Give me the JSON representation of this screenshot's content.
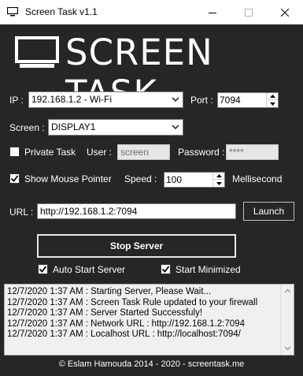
{
  "window": {
    "title": "Screen Task v1.1",
    "min_glyph": "—",
    "max_glyph": "☐",
    "close_glyph": "✕"
  },
  "brand": {
    "text": "SCREEN TASK"
  },
  "ip": {
    "label": "IP :",
    "value": "192.168.1.2 - Wi-Fi"
  },
  "port": {
    "label": "Port :",
    "value": "7094"
  },
  "screen": {
    "label": "Screen :",
    "value": "DISPLAY1"
  },
  "private_task": {
    "label": "Private Task",
    "checked": false
  },
  "user": {
    "label": "User :",
    "value": "screen"
  },
  "password": {
    "label": "Password :",
    "value": "****"
  },
  "mouse_pointer": {
    "label": "Show Mouse Pointer",
    "checked": true
  },
  "speed": {
    "label": "Speed :",
    "value": "100",
    "unit": "Mellisecond"
  },
  "url": {
    "label": "URL :",
    "value": "http://192.168.1.2:7094"
  },
  "launch_button": "Launch",
  "stop_button": "Stop Server",
  "auto_start": {
    "label": "Auto Start Server",
    "checked": true
  },
  "start_minimized": {
    "label": "Start Minimized",
    "checked": true
  },
  "log": {
    "lines": [
      "12/7/2020 1:37 AM : Starting Server, Please Wait...",
      "12/7/2020 1:37 AM : Screen Task Rule updated to your firewall",
      "12/7/2020 1:37 AM : Server Started Successfuly!",
      "12/7/2020 1:37 AM : Network URL : http://192.168.1.2:7094",
      "12/7/2020 1:37 AM : Localhost URL : http://localhost:7094/"
    ]
  },
  "footer": "© Eslam Hamouda 2014 - 2020 - screentask.me",
  "colors": {
    "background": "#262626",
    "titlebar": "#ffffff",
    "text": "#ffffff",
    "log_bg": "#f0f0f0"
  }
}
